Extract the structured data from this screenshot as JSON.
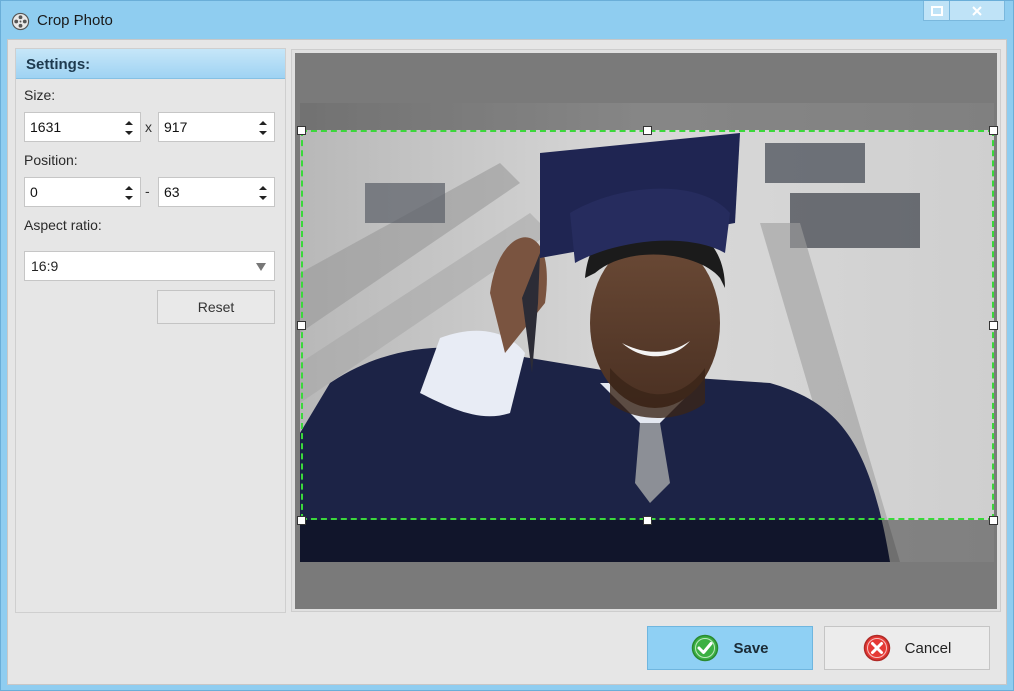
{
  "window": {
    "title": "Crop Photo",
    "icon": "film-reel-icon"
  },
  "settings": {
    "header": "Settings:",
    "size_label": "Size:",
    "width": "1631",
    "height": "917",
    "size_separator": "x",
    "position_label": "Position:",
    "pos_x": "0",
    "pos_y": "63",
    "position_separator": "-",
    "aspect_label": "Aspect ratio:",
    "aspect_value": "16:9",
    "reset_label": "Reset"
  },
  "preview": {
    "image_subject": "graduate in cap and gown",
    "crop_color": "#3bd83b"
  },
  "footer": {
    "save_label": "Save",
    "save_icon": "check-circle-icon",
    "cancel_label": "Cancel",
    "cancel_icon": "x-circle-icon"
  },
  "colors": {
    "titlebar": "#8fcdf0",
    "accent": "#8fd0f4",
    "crop_border": "#3bd83b"
  }
}
